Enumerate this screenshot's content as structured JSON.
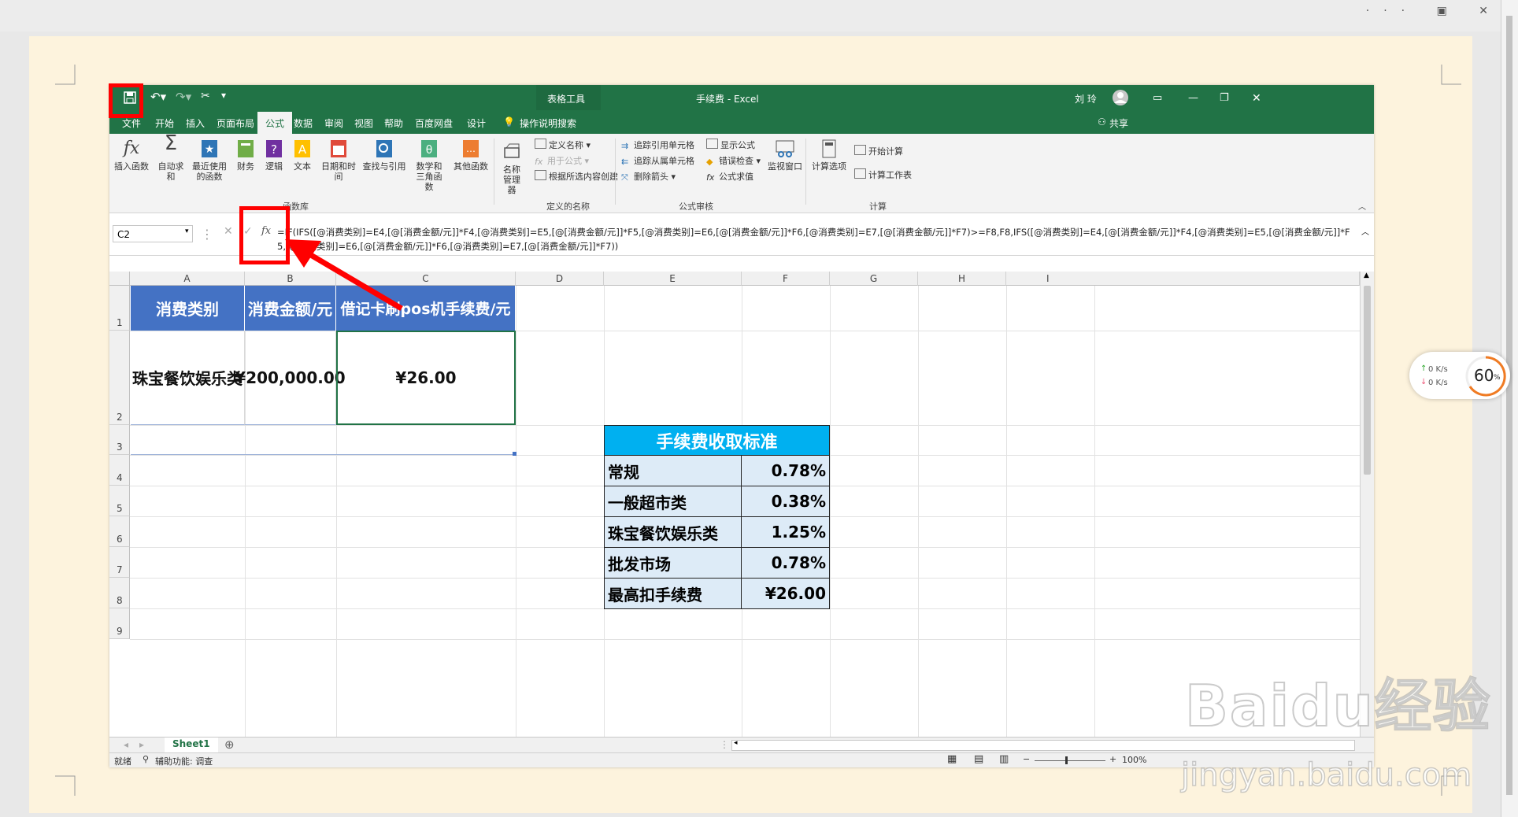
{
  "title": {
    "tools": "表格工具",
    "window": "手续费 - Excel",
    "user": "刘 玲"
  },
  "tabs": [
    "文件",
    "开始",
    "插入",
    "页面布局",
    "公式",
    "数据",
    "审阅",
    "视图",
    "帮助",
    "百度网盘",
    "设计"
  ],
  "tell_me": "操作说明搜索",
  "share": "共享",
  "ribbon": {
    "func_lib": [
      "插入函数",
      "自动求和",
      "最近使用的函数",
      "财务",
      "逻辑",
      "文本",
      "日期和时间",
      "查找与引用",
      "数学和三角函数",
      "其他函数"
    ],
    "func_lib_label": "函数库",
    "names": {
      "manager": "名称管理器",
      "define": "定义名称",
      "use": "用于公式",
      "create": "根据所选内容创建",
      "label": "定义的名称"
    },
    "audit": {
      "trace_pre": "追踪引用单元格",
      "trace_dep": "追踪从属单元格",
      "remove": "删除箭头",
      "show": "显示公式",
      "check": "错误检查",
      "eval": "公式求值",
      "watch": "监视窗口",
      "label": "公式审核"
    },
    "calc": {
      "options": "计算选项",
      "now": "开始计算",
      "sheet": "计算工作表",
      "label": "计算"
    }
  },
  "namebox": "C2",
  "formula": "=IF(IFS([@消费类别]=E4,[@[消费金额/元]]*F4,[@消费类别]=E5,[@[消费金额/元]]*F5,[@消费类别]=E6,[@[消费金额/元]]*F6,[@消费类别]=E7,[@[消费金额/元]]*F7)>=F8,F8,IFS([@消费类别]=E4,[@[消费金额/元]]*F4,[@消费类别]=E5,[@[消费金额/元]]*F5,[@消费类别]=E6,[@[消费金额/元]]*F6,[@消费类别]=E7,[@[消费金额/元]]*F7))",
  "columns": [
    "A",
    "B",
    "C",
    "D",
    "E",
    "F",
    "G",
    "H",
    "I"
  ],
  "rows": [
    "1",
    "2",
    "3",
    "4",
    "5",
    "6",
    "7",
    "8",
    "9"
  ],
  "table": {
    "headers": [
      "消费类别",
      "消费金额/元",
      "借记卡刷pos机手续费/元"
    ],
    "row": [
      "珠宝餐饮娱乐类",
      "¥200,000.00",
      "¥26.00"
    ]
  },
  "fees": {
    "title": "手续费收取标准",
    "items": [
      {
        "name": "常规",
        "value": "0.78%"
      },
      {
        "name": "一般超市类",
        "value": "0.38%"
      },
      {
        "name": "珠宝餐饮娱乐类",
        "value": "1.25%"
      },
      {
        "name": "批发市场",
        "value": "0.78%"
      },
      {
        "name": "最高扣手续费",
        "value": "¥26.00"
      }
    ]
  },
  "sheet_tab": "Sheet1",
  "status": {
    "ready": "就绪",
    "accessibility": "辅助功能: 调查",
    "zoom": "100%"
  },
  "speed": {
    "up": "0  K/s",
    "down": "0  K/s",
    "percent": "60",
    "unit": "%"
  },
  "watermark": {
    "brand": "Baidu经验",
    "url": "jingyan.baidu.com"
  },
  "colors": {
    "excel_green": "#217346",
    "header_blue": "#4472c4",
    "fee_title": "#00b0f0",
    "fee_bg": "#ddebf7",
    "annotation_red": "#ff0000"
  }
}
